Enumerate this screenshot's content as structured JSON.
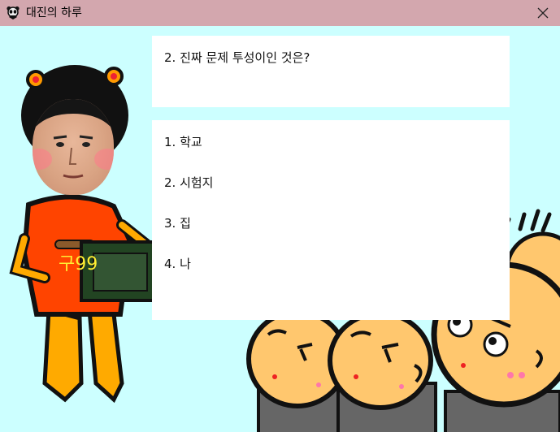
{
  "window": {
    "title": "대진의 하루",
    "icon": "panda-icon",
    "close_icon": "close-icon"
  },
  "question": {
    "text": "2. 진짜 문제 투성이인 것은?"
  },
  "answers": [
    {
      "label": "1. 학교"
    },
    {
      "label": "2. 시험지"
    },
    {
      "label": "3. 집"
    },
    {
      "label": "4. 나"
    }
  ],
  "player_shirt_text": "구99",
  "colors": {
    "stage_bg": "#ccffff",
    "titlebar_bg": "#d3a7ae",
    "shirt": "#ff4400",
    "skin_cartoon": "#ffc76e"
  }
}
